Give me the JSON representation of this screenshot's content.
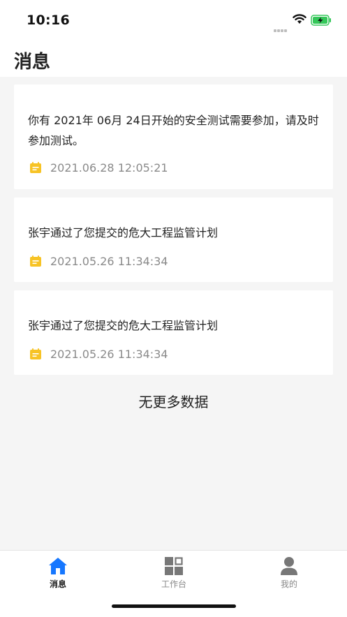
{
  "status_bar": {
    "time": "10:16"
  },
  "header": {
    "title": "消息"
  },
  "messages": [
    {
      "text": "你有 2021年 06月 24日开始的安全测试需要参加，请及时参加测试。",
      "date": "2021.06.28 12:05:21"
    },
    {
      "text": "张宇通过了您提交的危大工程监管计划",
      "date": "2021.05.26 11:34:34"
    },
    {
      "text": "张宇通过了您提交的危大工程监管计划",
      "date": "2021.05.26 11:34:34"
    }
  ],
  "list_footer": "无更多数据",
  "tab_bar": {
    "items": [
      {
        "label": "消息",
        "icon": "home-icon",
        "active": true
      },
      {
        "label": "工作台",
        "icon": "grid-icon",
        "active": false
      },
      {
        "label": "我的",
        "icon": "user-icon",
        "active": false
      }
    ]
  },
  "colors": {
    "accent": "#1677ff",
    "date_icon": "#f7c325",
    "inactive_icon": "#777777",
    "battery_green": "#34c759"
  }
}
